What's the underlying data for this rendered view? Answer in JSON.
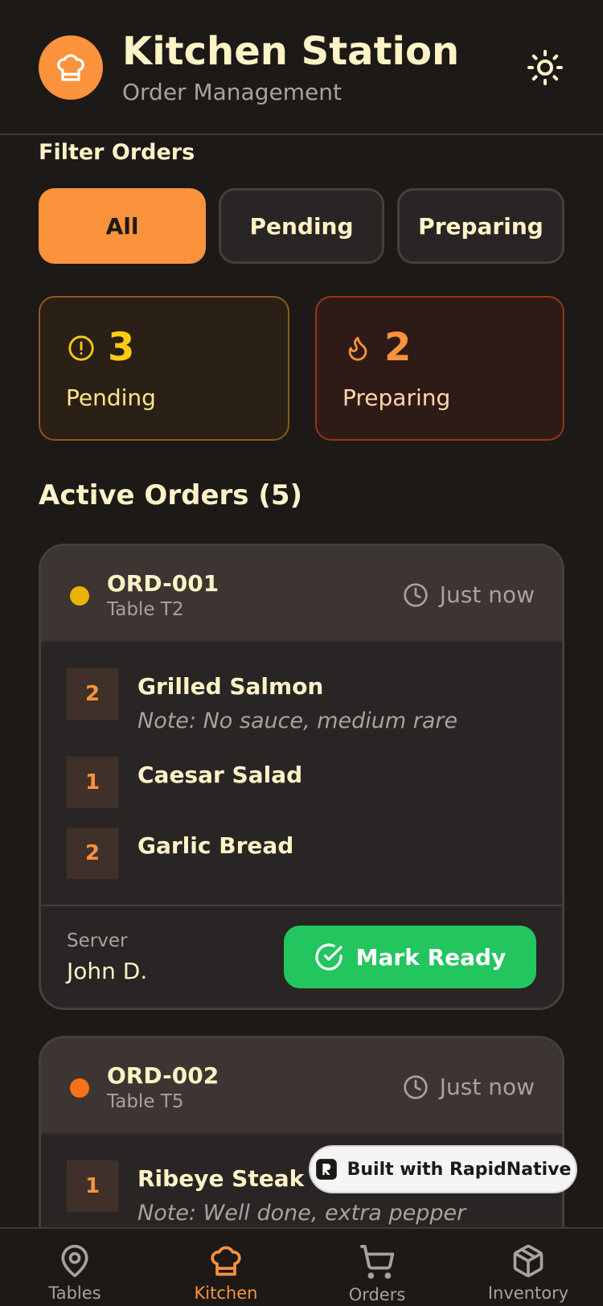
{
  "header": {
    "title": "Kitchen Station",
    "subtitle": "Order Management"
  },
  "filters": {
    "label": "Filter Orders",
    "options": [
      "All",
      "Pending",
      "Preparing"
    ],
    "selected": "All"
  },
  "stats": {
    "pending": {
      "count": "3",
      "label": "Pending"
    },
    "preparing": {
      "count": "2",
      "label": "Preparing"
    }
  },
  "section": {
    "title": "Active Orders (5)"
  },
  "orders": [
    {
      "id": "ORD-001",
      "table": "Table T2",
      "time": "Just now",
      "status_color": "#eab308",
      "items": [
        {
          "qty": "2",
          "name": "Grilled Salmon",
          "note": "Note: No sauce, medium rare"
        },
        {
          "qty": "1",
          "name": "Caesar Salad"
        },
        {
          "qty": "2",
          "name": "Garlic Bread"
        }
      ],
      "server_label": "Server",
      "server": "John D.",
      "action": "Mark Ready"
    },
    {
      "id": "ORD-002",
      "table": "Table T5",
      "time": "Just now",
      "status_color": "#f97316",
      "items": [
        {
          "qty": "1",
          "name": "Ribeye Steak",
          "note": "Note: Well done, extra pepper"
        }
      ]
    }
  ],
  "badge": {
    "label": "Built with RapidNative"
  },
  "nav": {
    "items": [
      {
        "label": "Tables",
        "icon": "map-pin-icon"
      },
      {
        "label": "Kitchen",
        "icon": "chef-hat-icon"
      },
      {
        "label": "Orders",
        "icon": "cart-icon"
      },
      {
        "label": "Inventory",
        "icon": "package-icon"
      }
    ],
    "active": "Kitchen"
  },
  "colors": {
    "accent": "#fb923c",
    "success": "#22c55e",
    "background": "#1c1917"
  }
}
